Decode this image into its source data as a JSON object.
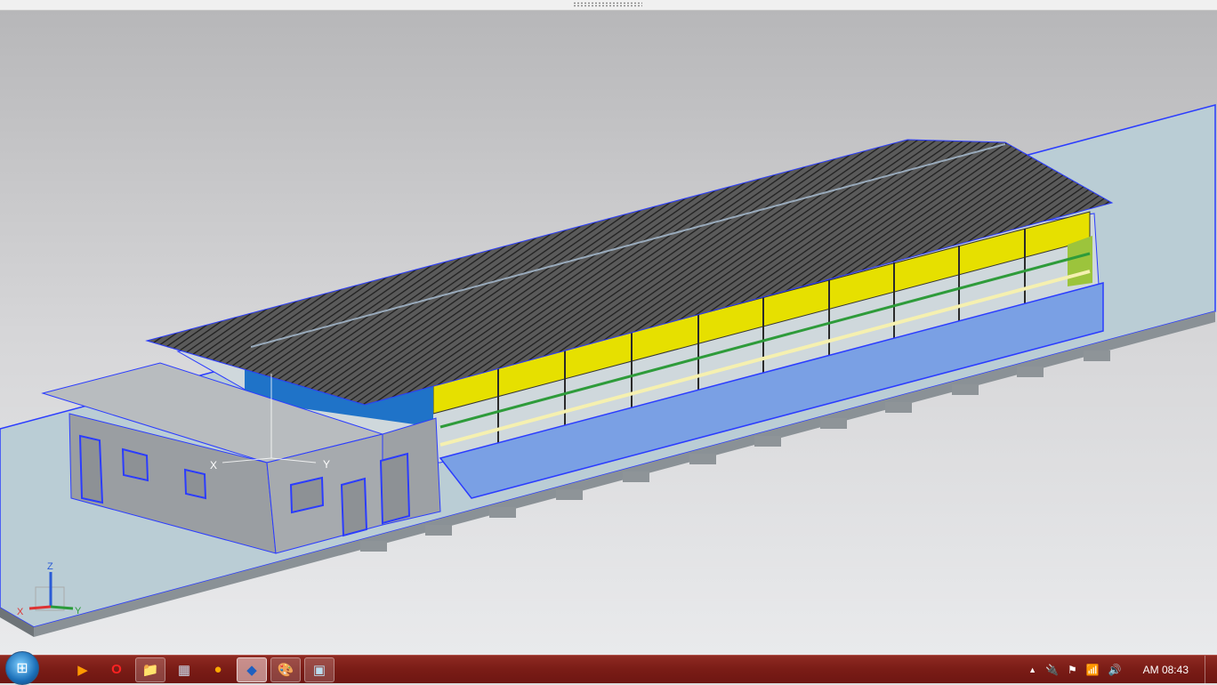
{
  "window": {
    "grip": "resize-grip"
  },
  "viewport": {
    "model": "building-3d-model",
    "wcs_labels": {
      "x": "X",
      "y": "Y"
    },
    "triad_labels": {
      "x": "X",
      "y": "Y",
      "z": "Z"
    },
    "colors": {
      "roof": "#4a4a4a",
      "yellow": "#e6e000",
      "wall_blue": "#7aa0e4",
      "edge": "#2b3cff",
      "slab": "#b9ccd4",
      "annex": "#9a9ea2"
    }
  },
  "taskbar": {
    "start": "start-button",
    "apps": [
      {
        "name": "media-player",
        "icon": "▶",
        "active": false
      },
      {
        "name": "opera",
        "icon": "O",
        "active": false
      },
      {
        "name": "file-explorer",
        "icon": "📁",
        "active": true
      },
      {
        "name": "calculator",
        "icon": "▦",
        "active": false
      },
      {
        "name": "messenger",
        "icon": "●",
        "active": false
      },
      {
        "name": "cad-app",
        "icon": "◆",
        "active": true
      },
      {
        "name": "paint",
        "icon": "🎨",
        "active": true
      },
      {
        "name": "picture-viewer",
        "icon": "▣",
        "active": true
      }
    ],
    "tray": {
      "show_hidden": "▲",
      "power": "🔌",
      "flag": "⚑",
      "network": "📶",
      "volume": "🔊",
      "clock": "AM 08:43"
    }
  }
}
